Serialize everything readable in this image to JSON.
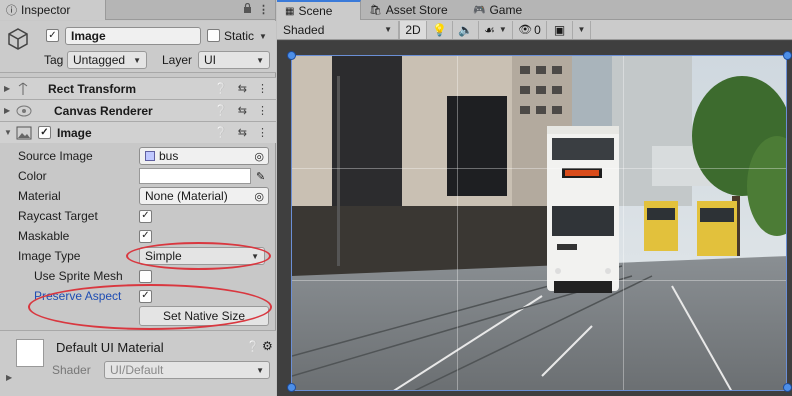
{
  "inspector": {
    "tab_title": "Inspector",
    "object_name": "Image",
    "static_label": "Static",
    "tag_label": "Tag",
    "tag_value": "Untagged",
    "layer_label": "Layer",
    "layer_value": "UI"
  },
  "components": {
    "rect_transform": "Rect Transform",
    "canvas_renderer": "Canvas Renderer",
    "image": "Image"
  },
  "image_props": {
    "source_image_label": "Source Image",
    "source_image_value": "bus",
    "color_label": "Color",
    "material_label": "Material",
    "material_value": "None (Material)",
    "raycast_label": "Raycast Target",
    "maskable_label": "Maskable",
    "image_type_label": "Image Type",
    "image_type_value": "Simple",
    "use_sprite_mesh_label": "Use Sprite Mesh",
    "preserve_aspect_label": "Preserve Aspect",
    "set_native_size_label": "Set Native Size"
  },
  "material": {
    "name": "Default UI Material",
    "shader_label": "Shader",
    "shader_value": "UI/Default"
  },
  "scene": {
    "tabs": [
      "Scene",
      "Asset Store",
      "Game"
    ],
    "shading_mode": "Shaded",
    "mode_2d": "2D",
    "hidden_count": "0"
  },
  "colors": {
    "accent": "#3a7ad9",
    "highlight_ellipse": "#d9373f",
    "preserve_aspect_label_color": "#1f4db3"
  },
  "icons": [
    "info-icon",
    "cube-icon",
    "help-icon",
    "settings-sliders-icon",
    "kebab-menu-icon",
    "eyedropper-icon",
    "target-icon",
    "lock-icon",
    "lightbulb-icon",
    "audio-icon",
    "effects-icon",
    "visibility-off-icon",
    "gizmos-icon",
    "chevron-down-icon",
    "image-component-icon",
    "canvas-renderer-icon",
    "scene-tab-icon",
    "asset-store-icon",
    "game-tab-icon"
  ]
}
